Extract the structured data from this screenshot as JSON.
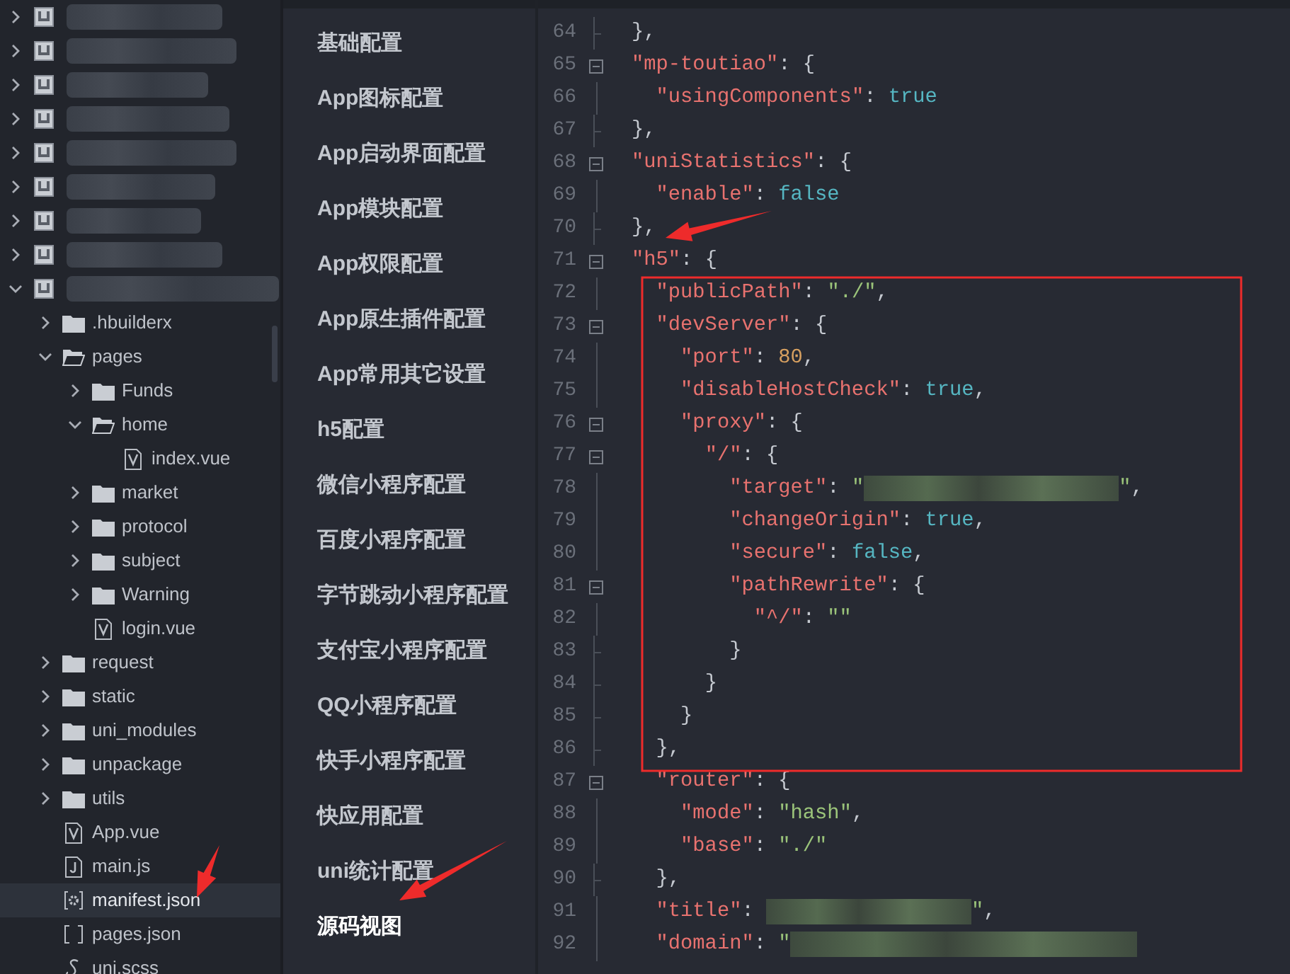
{
  "file_tree": [
    {
      "kind": "project",
      "expanded": false,
      "selected": false
    },
    {
      "kind": "project",
      "expanded": false,
      "selected": false
    },
    {
      "kind": "project",
      "expanded": false,
      "selected": false
    },
    {
      "kind": "project",
      "expanded": false,
      "selected": false
    },
    {
      "kind": "project",
      "expanded": false,
      "selected": false
    },
    {
      "kind": "project",
      "expanded": false,
      "selected": false
    },
    {
      "kind": "project",
      "expanded": false,
      "selected": false
    },
    {
      "kind": "project",
      "expanded": false,
      "selected": false
    },
    {
      "kind": "project",
      "expanded": true,
      "selected": false,
      "children": [
        {
          "kind": "folder",
          "label": ".hbuilderx",
          "expanded": false,
          "selected": false
        },
        {
          "kind": "folder",
          "label": "pages",
          "expanded": true,
          "selected": false,
          "children": [
            {
              "kind": "folder",
              "label": "Funds",
              "expanded": false,
              "selected": false
            },
            {
              "kind": "folder",
              "label": "home",
              "expanded": true,
              "selected": false,
              "children": [
                {
                  "kind": "vue",
                  "label": "index.vue",
                  "selected": false
                }
              ]
            },
            {
              "kind": "folder",
              "label": "market",
              "expanded": false,
              "selected": false
            },
            {
              "kind": "folder",
              "label": "protocol",
              "expanded": false,
              "selected": false
            },
            {
              "kind": "folder",
              "label": "subject",
              "expanded": false,
              "selected": false
            },
            {
              "kind": "folder",
              "label": "Warning",
              "expanded": false,
              "selected": false
            },
            {
              "kind": "vue",
              "label": "login.vue",
              "selected": false
            }
          ]
        },
        {
          "kind": "folder",
          "label": "request",
          "expanded": false,
          "selected": false
        },
        {
          "kind": "folder",
          "label": "static",
          "expanded": false,
          "selected": false
        },
        {
          "kind": "folder",
          "label": "uni_modules",
          "expanded": false,
          "selected": false
        },
        {
          "kind": "folder",
          "label": "unpackage",
          "expanded": false,
          "selected": false
        },
        {
          "kind": "folder",
          "label": "utils",
          "expanded": false,
          "selected": false
        },
        {
          "kind": "vue",
          "label": "App.vue",
          "selected": false
        },
        {
          "kind": "js",
          "label": "main.js",
          "selected": false
        },
        {
          "kind": "manifest",
          "label": "manifest.json",
          "selected": true
        },
        {
          "kind": "json",
          "label": "pages.json",
          "selected": false
        },
        {
          "kind": "style",
          "label": "uni.scss",
          "selected": false
        }
      ]
    }
  ],
  "config_nav": [
    {
      "label": "基础配置",
      "selected": false
    },
    {
      "label": "App图标配置",
      "selected": false
    },
    {
      "label": "App启动界面配置",
      "selected": false
    },
    {
      "label": "App模块配置",
      "selected": false
    },
    {
      "label": "App权限配置",
      "selected": false
    },
    {
      "label": "App原生插件配置",
      "selected": false
    },
    {
      "label": "App常用其它设置",
      "selected": false
    },
    {
      "label": "h5配置",
      "selected": false
    },
    {
      "label": "微信小程序配置",
      "selected": false
    },
    {
      "label": "百度小程序配置",
      "selected": false
    },
    {
      "label": "字节跳动小程序配置",
      "selected": false
    },
    {
      "label": "支付宝小程序配置",
      "selected": false
    },
    {
      "label": "QQ小程序配置",
      "selected": false
    },
    {
      "label": "快手小程序配置",
      "selected": false
    },
    {
      "label": "快应用配置",
      "selected": false
    },
    {
      "label": "uni统计配置",
      "selected": false
    },
    {
      "label": "源码视图",
      "selected": true
    }
  ],
  "editor": {
    "lines": [
      {
        "number": "64",
        "kind": "end",
        "tokens": [
          {
            "kind": "punct",
            "text": "},"
          }
        ]
      },
      {
        "number": "65",
        "kind": "fold",
        "tokens": [
          {
            "kind": "key",
            "text": "\"mp-toutiao\""
          },
          {
            "kind": "punct",
            "text": ": {"
          }
        ],
        "children": [
          {
            "number": "66",
            "kind": "line",
            "tokens": [
              {
                "kind": "key",
                "text": "\"usingComponents\""
              },
              {
                "kind": "punct",
                "text": ": "
              },
              {
                "kind": "bool",
                "text": "true"
              }
            ]
          }
        ]
      },
      {
        "number": "67",
        "kind": "end",
        "tokens": [
          {
            "kind": "punct",
            "text": "},"
          }
        ]
      },
      {
        "number": "68",
        "kind": "fold",
        "tokens": [
          {
            "kind": "key",
            "text": "\"uniStatistics\""
          },
          {
            "kind": "punct",
            "text": ": {"
          }
        ],
        "children": [
          {
            "number": "69",
            "kind": "line",
            "tokens": [
              {
                "kind": "key",
                "text": "\"enable\""
              },
              {
                "kind": "punct",
                "text": ": "
              },
              {
                "kind": "bool",
                "text": "false"
              }
            ]
          }
        ]
      },
      {
        "number": "70",
        "kind": "end",
        "tokens": [
          {
            "kind": "punct",
            "text": "},"
          }
        ]
      },
      {
        "number": "71",
        "kind": "fold",
        "tokens": [
          {
            "kind": "key",
            "text": "\"h5\""
          },
          {
            "kind": "punct",
            "text": ": {"
          }
        ],
        "children": [
          {
            "number": "72",
            "kind": "line",
            "tokens": [
              {
                "kind": "key",
                "text": "\"publicPath\""
              },
              {
                "kind": "punct",
                "text": ": "
              },
              {
                "kind": "str",
                "text": "\"./\""
              },
              {
                "kind": "punct",
                "text": ","
              }
            ]
          },
          {
            "number": "73",
            "kind": "fold",
            "tokens": [
              {
                "kind": "key",
                "text": "\"devServer\""
              },
              {
                "kind": "punct",
                "text": ": {"
              }
            ],
            "children": [
              {
                "number": "74",
                "kind": "line",
                "tokens": [
                  {
                    "kind": "key",
                    "text": "\"port\""
                  },
                  {
                    "kind": "punct",
                    "text": ": "
                  },
                  {
                    "kind": "num",
                    "text": "80"
                  },
                  {
                    "kind": "punct",
                    "text": ","
                  }
                ]
              },
              {
                "number": "75",
                "kind": "line",
                "tokens": [
                  {
                    "kind": "key",
                    "text": "\"disableHostCheck\""
                  },
                  {
                    "kind": "punct",
                    "text": ": "
                  },
                  {
                    "kind": "bool",
                    "text": "true"
                  },
                  {
                    "kind": "punct",
                    "text": ","
                  }
                ]
              },
              {
                "number": "76",
                "kind": "fold",
                "tokens": [
                  {
                    "kind": "key",
                    "text": "\"proxy\""
                  },
                  {
                    "kind": "punct",
                    "text": ": {"
                  }
                ],
                "children": [
                  {
                    "number": "77",
                    "kind": "fold",
                    "tokens": [
                      {
                        "kind": "key",
                        "text": "\"/\""
                      },
                      {
                        "kind": "punct",
                        "text": ": {"
                      }
                    ],
                    "children": [
                      {
                        "number": "78",
                        "kind": "line",
                        "tokens": [
                          {
                            "kind": "key",
                            "text": "\"target\""
                          },
                          {
                            "kind": "punct",
                            "text": ": "
                          },
                          {
                            "kind": "str",
                            "text": "\""
                          },
                          {
                            "kind": "redacted"
                          },
                          {
                            "kind": "str",
                            "text": "\""
                          },
                          {
                            "kind": "punct",
                            "text": ","
                          }
                        ]
                      },
                      {
                        "number": "79",
                        "kind": "line",
                        "tokens": [
                          {
                            "kind": "key",
                            "text": "\"changeOrigin\""
                          },
                          {
                            "kind": "punct",
                            "text": ": "
                          },
                          {
                            "kind": "bool",
                            "text": "true"
                          },
                          {
                            "kind": "punct",
                            "text": ","
                          }
                        ]
                      },
                      {
                        "number": "80",
                        "kind": "line",
                        "tokens": [
                          {
                            "kind": "key",
                            "text": "\"secure\""
                          },
                          {
                            "kind": "punct",
                            "text": ": "
                          },
                          {
                            "kind": "bool",
                            "text": "false"
                          },
                          {
                            "kind": "punct",
                            "text": ","
                          }
                        ]
                      },
                      {
                        "number": "81",
                        "kind": "fold",
                        "tokens": [
                          {
                            "kind": "key",
                            "text": "\"pathRewrite\""
                          },
                          {
                            "kind": "punct",
                            "text": ": {"
                          }
                        ],
                        "children": [
                          {
                            "number": "82",
                            "kind": "line",
                            "tokens": [
                              {
                                "kind": "key",
                                "text": "\"^/\""
                              },
                              {
                                "kind": "punct",
                                "text": ": "
                              },
                              {
                                "kind": "str",
                                "text": "\"\""
                              }
                            ]
                          }
                        ]
                      },
                      {
                        "number": "83",
                        "kind": "end",
                        "tokens": [
                          {
                            "kind": "punct",
                            "text": "}"
                          }
                        ]
                      }
                    ]
                  },
                  {
                    "number": "84",
                    "kind": "end",
                    "tokens": [
                      {
                        "kind": "punct",
                        "text": "}"
                      }
                    ]
                  }
                ]
              },
              {
                "number": "85",
                "kind": "end",
                "tokens": [
                  {
                    "kind": "punct",
                    "text": "}"
                  }
                ]
              }
            ]
          },
          {
            "number": "86",
            "kind": "end",
            "tokens": [
              {
                "kind": "punct",
                "text": "},"
              }
            ]
          },
          {
            "number": "87",
            "kind": "fold",
            "tokens": [
              {
                "kind": "key",
                "text": "\"router\""
              },
              {
                "kind": "punct",
                "text": ": {"
              }
            ],
            "children": [
              {
                "number": "88",
                "kind": "line",
                "tokens": [
                  {
                    "kind": "key",
                    "text": "\"mode\""
                  },
                  {
                    "kind": "punct",
                    "text": ": "
                  },
                  {
                    "kind": "str",
                    "text": "\"hash\""
                  },
                  {
                    "kind": "punct",
                    "text": ","
                  }
                ]
              },
              {
                "number": "89",
                "kind": "line",
                "tokens": [
                  {
                    "kind": "key",
                    "text": "\"base\""
                  },
                  {
                    "kind": "punct",
                    "text": ": "
                  },
                  {
                    "kind": "str",
                    "text": "\"./\""
                  }
                ]
              }
            ]
          },
          {
            "number": "90",
            "kind": "end",
            "tokens": [
              {
                "kind": "punct",
                "text": "},"
              }
            ]
          },
          {
            "number": "91",
            "kind": "line",
            "tokens": [
              {
                "kind": "key",
                "text": "\"title\""
              },
              {
                "kind": "punct",
                "text": ": "
              },
              {
                "kind": "redacted"
              },
              {
                "kind": "str",
                "text": "\""
              },
              {
                "kind": "punct",
                "text": ","
              }
            ]
          },
          {
            "number": "92",
            "kind": "line",
            "tokens": [
              {
                "kind": "key",
                "text": "\"domain\""
              },
              {
                "kind": "punct",
                "text": ": "
              },
              {
                "kind": "str",
                "text": "\""
              },
              {
                "kind": "redacted"
              }
            ]
          }
        ]
      }
    ]
  },
  "annotations": [
    {
      "kind": "box"
    },
    {
      "kind": "arrow"
    },
    {
      "kind": "arrow"
    },
    {
      "kind": "arrow"
    }
  ]
}
